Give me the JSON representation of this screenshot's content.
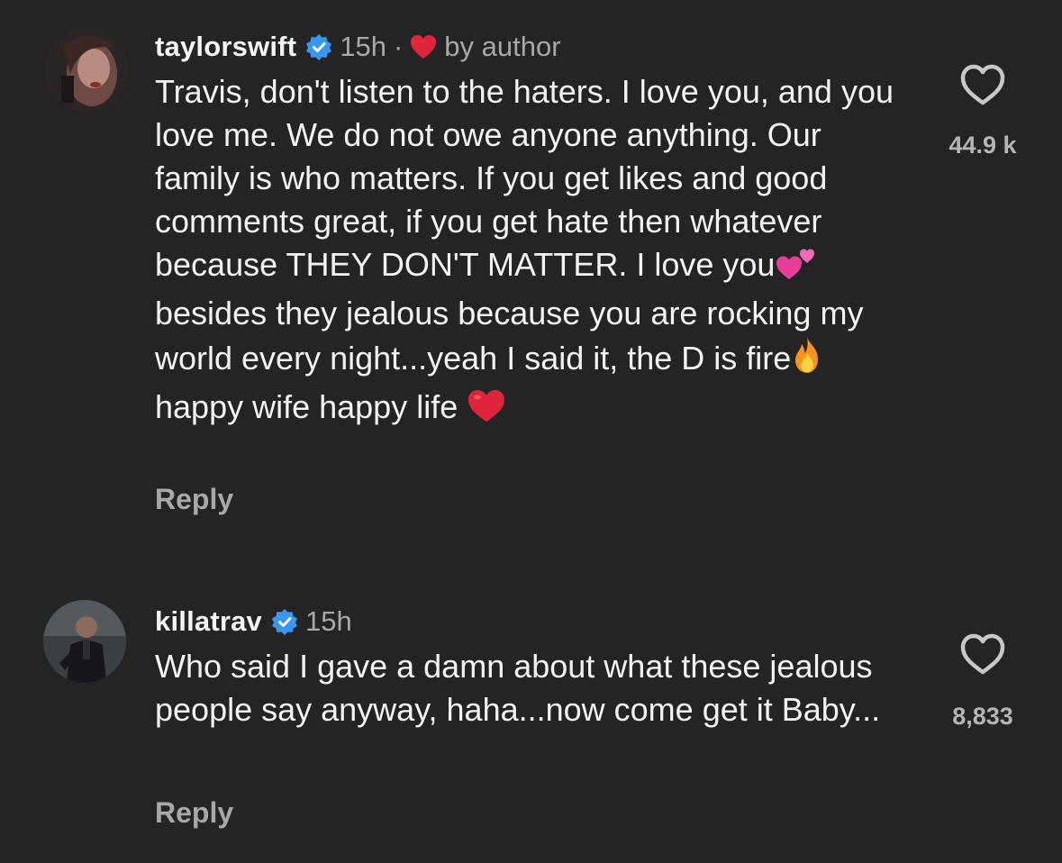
{
  "comments": [
    {
      "username": "taylorswift",
      "time": "15h",
      "separator": "·",
      "author_badge": "by author",
      "author_badge_icon": "red-heart-icon",
      "text_parts": [
        "Travis, don't listen to the haters. I love you, and you love me. We do not owe anyone anything. Our family is who matters. If you get likes and good comments great, if you get hate then whatever because THEY DON'T MATTER. I love you",
        " besides they jealous because you are rocking my world every night...yeah I said it, the D is fire",
        " happy wife happy life "
      ],
      "emojis": [
        "two-hearts-emoji",
        "fire-emoji",
        "red-heart-emoji"
      ],
      "reply_label": "Reply",
      "likes": "44.9 k",
      "verified": true
    },
    {
      "username": "killatrav",
      "time": "15h",
      "text": "Who said I gave a damn about what these jealous people say anyway, haha...now come get it Baby...",
      "reply_label": "Reply",
      "likes": "8,833",
      "verified": true
    }
  ],
  "colors": {
    "background": "#242424",
    "text": "#f3f3f3",
    "muted": "#a8a8a8",
    "verified_blue": "#3897f0",
    "heart_red": "#ed4956"
  }
}
